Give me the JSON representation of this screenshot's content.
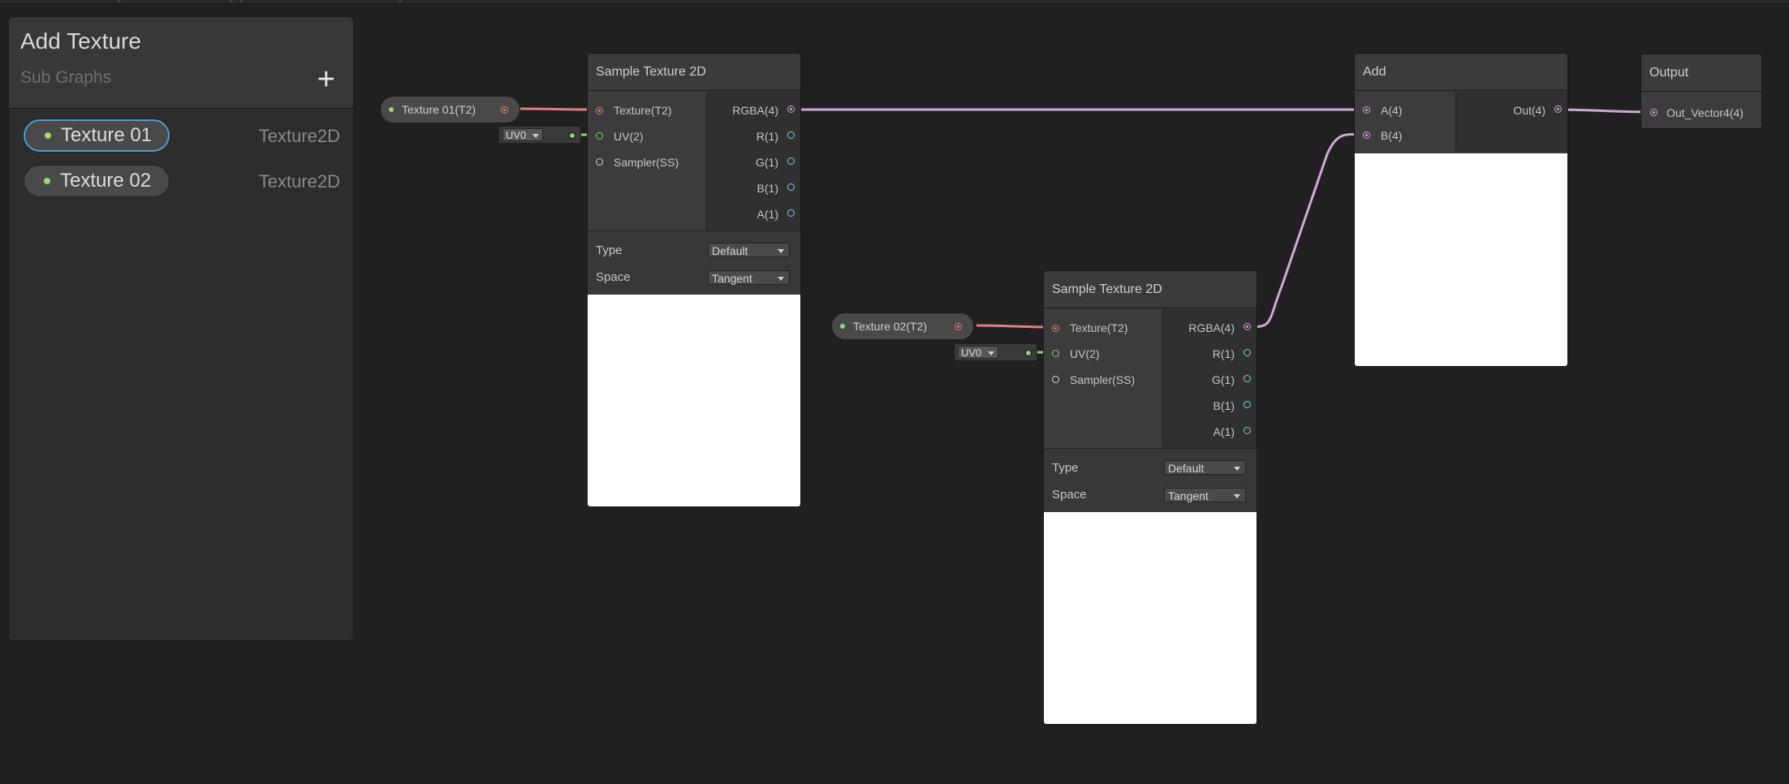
{
  "blackboard": {
    "title": "Add Texture",
    "subtitle": "Sub Graphs",
    "add_label": "+",
    "properties": [
      {
        "name": "Texture 01",
        "type": "Texture2D"
      },
      {
        "name": "Texture 02",
        "type": "Texture2D"
      }
    ]
  },
  "graph": {
    "chips": [
      "Texture 01(T2)",
      "Texture 02(T2)"
    ],
    "uv_value": "UV0",
    "sample1": {
      "title": "Sample Texture 2D",
      "inputs": [
        "Texture(T2)",
        "UV(2)",
        "Sampler(SS)"
      ],
      "outputs": [
        "RGBA(4)",
        "R(1)",
        "G(1)",
        "B(1)",
        "A(1)"
      ],
      "type_label": "Type",
      "type_value": "Default",
      "space_label": "Space",
      "space_value": "Tangent"
    },
    "sample2": {
      "title": "Sample Texture 2D",
      "inputs": [
        "Texture(T2)",
        "UV(2)",
        "Sampler(SS)"
      ],
      "outputs": [
        "RGBA(4)",
        "R(1)",
        "G(1)",
        "B(1)",
        "A(1)"
      ],
      "type_label": "Type",
      "type_value": "Default",
      "space_label": "Space",
      "space_value": "Tangent"
    },
    "add": {
      "title": "Add",
      "inputs": [
        "A(4)",
        "B(4)"
      ],
      "output": "Out(4)"
    },
    "output": {
      "title": "Output",
      "input": "Out_Vector4(4)"
    }
  },
  "colors": {
    "wire_texture": "#e07f7f",
    "wire_vector4": "#d1a6d9",
    "wire_vector2": "#8ad67a",
    "selection": "#4e9ed6"
  }
}
